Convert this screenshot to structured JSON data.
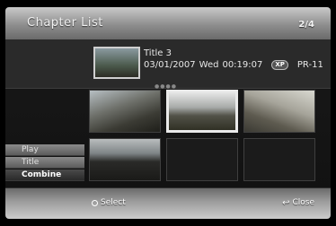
{
  "window": {
    "title": "Chapter List",
    "page_indicator": "2/4"
  },
  "info": {
    "title": "Title 3",
    "date": "03/01/2007",
    "weekday": "Wed",
    "time": "00:19:07",
    "badge": "XP",
    "program": "PR-11"
  },
  "page_dots": "●●●●",
  "menu": {
    "items": [
      {
        "label": "Play"
      },
      {
        "label": "Title"
      },
      {
        "label": "Combine"
      }
    ],
    "selected_index": 2
  },
  "hints": {
    "select": "Select",
    "close": "Close"
  },
  "icons": {
    "select": "circle-icon",
    "close": "return-icon"
  }
}
